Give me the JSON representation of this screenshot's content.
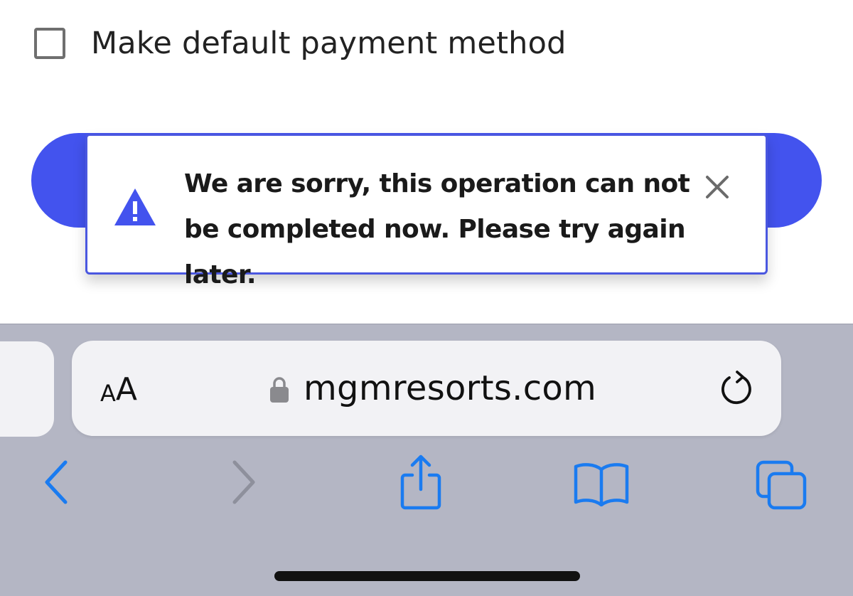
{
  "form": {
    "default_payment_label": "Make default payment method",
    "default_payment_checked": false
  },
  "colors": {
    "accent": "#4353ee",
    "toast_border": "#4a57e0",
    "toolbar_icon": "#1a7bf0",
    "toolbar_icon_disabled": "#8e909c",
    "browser_bar": "#b4b6c4"
  },
  "toast": {
    "message": "We are sorry, this operation can not be completed now. Please try again later.",
    "icon": "warning-triangle-icon",
    "close_icon": "close-icon"
  },
  "browser": {
    "text_size_small": "A",
    "text_size_large": "A",
    "url": "mgmresorts.com",
    "lock_icon": "lock-icon",
    "reload_icon": "reload-icon",
    "toolbar": [
      {
        "name": "back",
        "icon": "chevron-left-icon",
        "enabled": true
      },
      {
        "name": "forward",
        "icon": "chevron-right-icon",
        "enabled": false
      },
      {
        "name": "share",
        "icon": "share-icon",
        "enabled": true
      },
      {
        "name": "bookmarks",
        "icon": "book-icon",
        "enabled": true
      },
      {
        "name": "tabs",
        "icon": "tabs-icon",
        "enabled": true
      }
    ]
  }
}
